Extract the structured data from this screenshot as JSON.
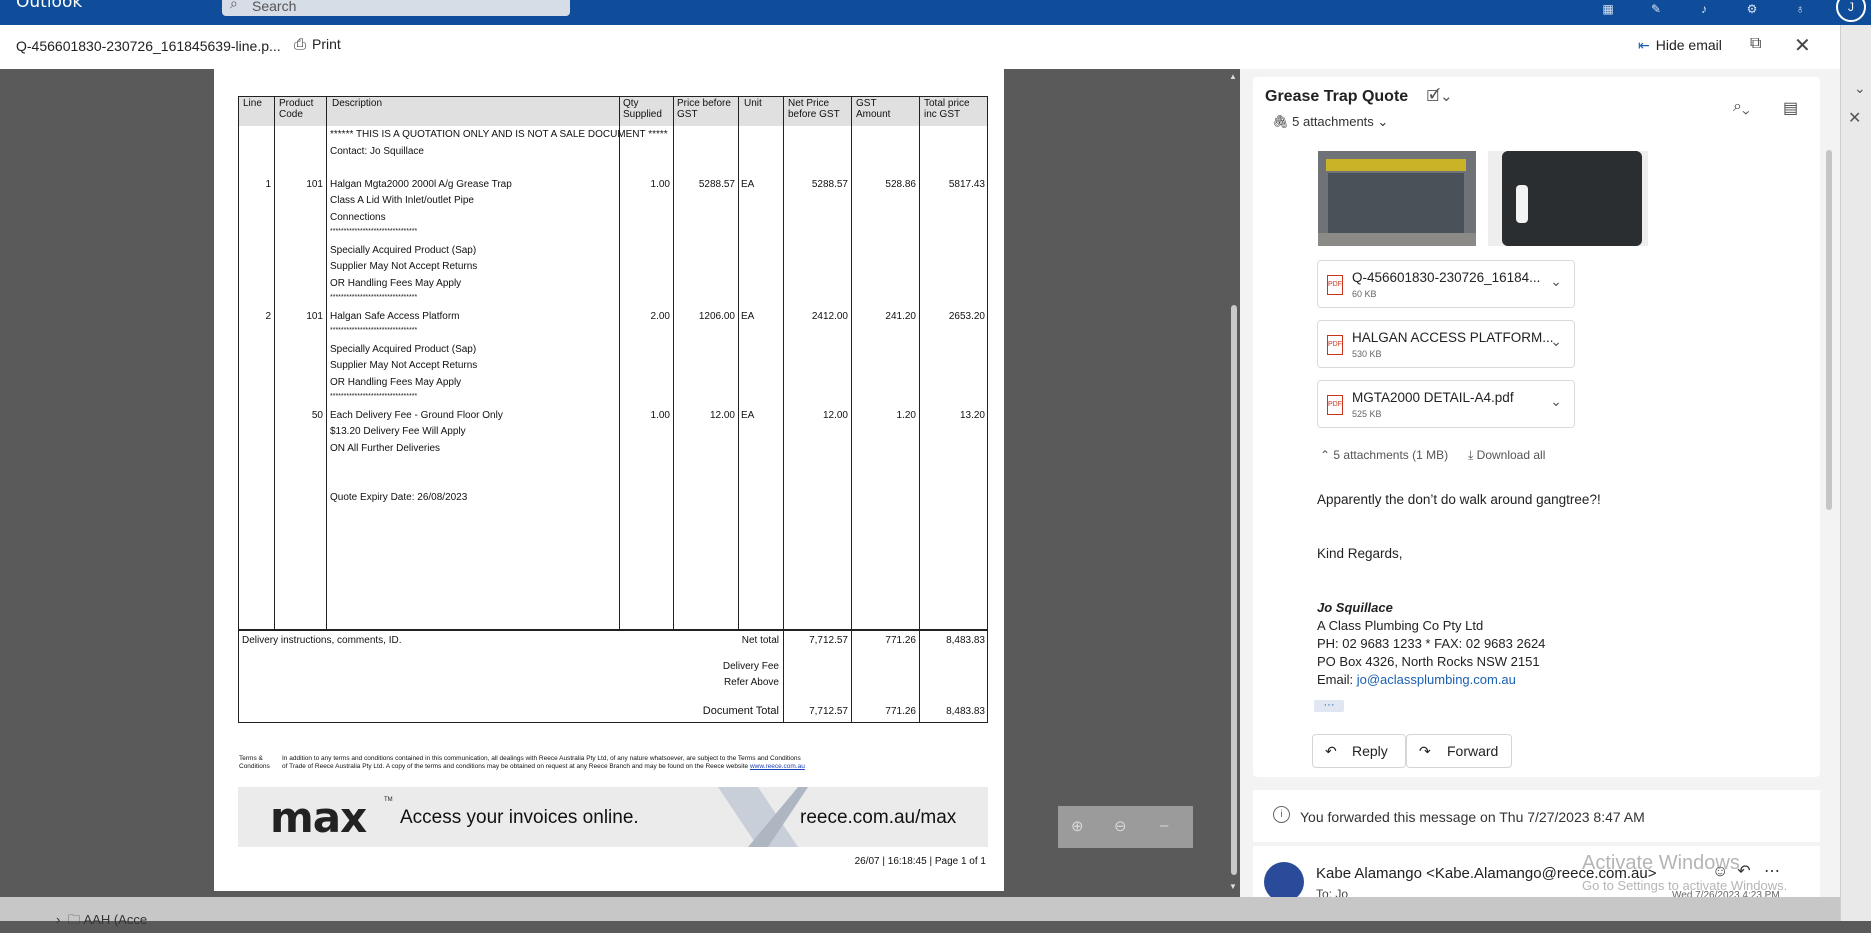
{
  "app": {
    "name": "Outlook",
    "search_placeholder": "Search"
  },
  "viewer": {
    "filename": "Q-456601830-230726_161845639-line.p...",
    "print_label": "Print",
    "hide_email_label": "Hide email"
  },
  "quote": {
    "headers": [
      "Line",
      "Product Code",
      "Description",
      "Qty Supplied",
      "Price before GST",
      "Unit",
      "Net Price before GST",
      "GST Amount",
      "Total price inc GST"
    ],
    "desc_lines": [
      "****** THIS IS A QUOTATION ONLY AND IS NOT A SALE DOCUMENT *****",
      "Contact: Jo Squillace",
      "Halgan Mgta2000 2000l A/g Grease Trap",
      "Class A Lid With Inlet/outlet Pipe",
      "Connections",
      "********************************",
      "Specially Acquired Product (Sap)",
      "Supplier May Not Accept Returns",
      "OR Handling Fees May Apply",
      "********************************",
      "Halgan Safe Access Platform",
      "********************************",
      "Specially Acquired Product (Sap)",
      "Supplier May Not Accept Returns",
      "OR Handling Fees May Apply",
      "********************************",
      "Each Delivery Fee - Ground Floor Only",
      "$13.20 Delivery Fee Will Apply",
      "ON All Further Deliveries",
      "Quote Expiry Date: 26/08/2023"
    ],
    "rows": [
      {
        "line": "1",
        "code": "101",
        "qty": "1.00",
        "price": "5288.57",
        "unit": "EA",
        "net": "5288.57",
        "gst": "528.86",
        "total": "5817.43"
      },
      {
        "line": "2",
        "code": "101",
        "qty": "2.00",
        "price": "1206.00",
        "unit": "EA",
        "net": "2412.00",
        "gst": "241.20",
        "total": "2653.20"
      },
      {
        "line": "",
        "code": "50",
        "qty": "1.00",
        "price": "12.00",
        "unit": "EA",
        "net": "12.00",
        "gst": "1.20",
        "total": "13.20"
      }
    ],
    "footer": {
      "delivery_instructions": "Delivery instructions, comments, ID.",
      "net_total_label": "Net total",
      "net_total": "7,712.57",
      "net_gst": "771.26",
      "net_inc": "8,483.83",
      "delivery_fee_label": "Delivery Fee",
      "refer_above": "Refer Above",
      "document_total_label": "Document Total",
      "doc_total": "7,712.57",
      "doc_gst": "771.26",
      "doc_inc": "8,483.83"
    },
    "terms_label_1": "Terms &",
    "terms_label_2": "Conditions",
    "terms_text_1": "In addition to any terms and conditions contained in this communication, all dealings with Reece Australia Pty Ltd, of any nature whatsoever, are subject to the Terms and Conditions",
    "terms_text_2": "of Trade of Reece Australia Pty Ltd. A copy of the terms and conditions may be obtained on request at any Reece Branch and may be found on the Reece website",
    "terms_link": "www.reece.com.au",
    "banner_logo": "max",
    "banner_tm": "TM",
    "banner_text": "Access your invoices online.",
    "banner_url": "reece.com.au/max",
    "page_footer": "26/07 | 16:18:45 | Page 1 of 1"
  },
  "email": {
    "subject": "Grease Trap Quote",
    "attachments_label": "5 attachments",
    "attachments": [
      {
        "name": "Q-456601830-230726_16184...",
        "size": "60 KB"
      },
      {
        "name": "HALGAN ACCESS PLATFORM...",
        "size": "530 KB"
      },
      {
        "name": "MGTA2000 DETAIL-A4.pdf",
        "size": "525 KB"
      }
    ],
    "attach_summary": "5 attachments (1 MB)",
    "download_all": "Download all",
    "body_line": "Apparently the don’t do walk around gangtree?!",
    "regards": "Kind Regards,",
    "sig_name": "Jo Squillace",
    "sig_company": "A Class Plumbing Co Pty Ltd",
    "sig_phone": "PH: 02 9683 1233 * FAX: 02 9683 2624",
    "sig_po": "PO Box 4326, North Rocks NSW 2151",
    "sig_email_label": "Email: ",
    "sig_email": "jo@aclassplumbing.com.au",
    "more": "···",
    "reply": "Reply",
    "forward": "Forward",
    "forward_notice": "You forwarded this message on Thu 7/27/2023 8:47 AM",
    "next_from": "Kabe Alamango <Kabe.Alamango@reece.com.au>",
    "next_to": "To: Jo",
    "next_date": "Wed 7/26/2023 4:23 PM"
  },
  "watermark": {
    "line1": "Activate Windows",
    "line2": "Go to Settings to activate Windows."
  },
  "bottom": {
    "folder": "AAH (Acce"
  }
}
